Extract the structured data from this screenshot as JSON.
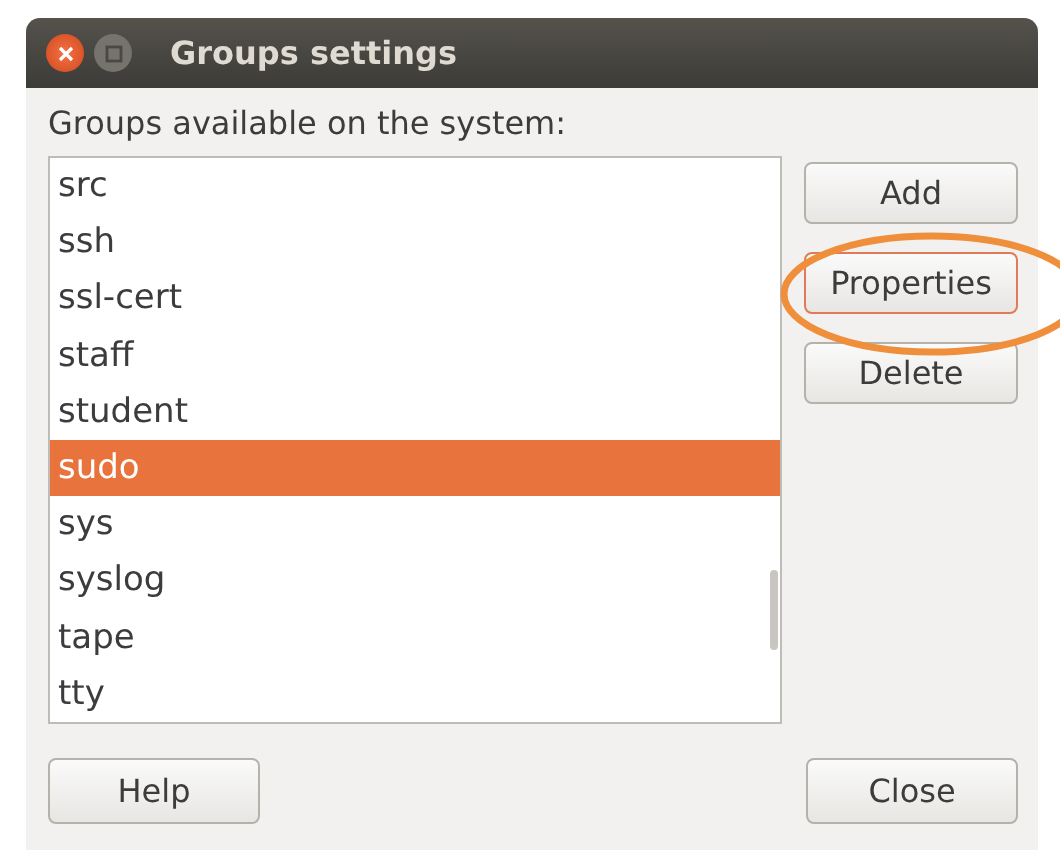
{
  "window": {
    "title": "Groups settings"
  },
  "label": "Groups available on the system:",
  "groups": [
    {
      "name": "src",
      "selected": false
    },
    {
      "name": "ssh",
      "selected": false
    },
    {
      "name": "ssl-cert",
      "selected": false
    },
    {
      "name": "staff",
      "selected": false
    },
    {
      "name": "student",
      "selected": false
    },
    {
      "name": "sudo",
      "selected": true
    },
    {
      "name": "sys",
      "selected": false
    },
    {
      "name": "syslog",
      "selected": false
    },
    {
      "name": "tape",
      "selected": false
    },
    {
      "name": "tty",
      "selected": false
    }
  ],
  "side_buttons": [
    {
      "label": "Add",
      "highlighted": false
    },
    {
      "label": "Properties",
      "highlighted": true
    },
    {
      "label": "Delete",
      "highlighted": false
    }
  ],
  "footer_buttons": [
    "Help",
    "Close"
  ]
}
